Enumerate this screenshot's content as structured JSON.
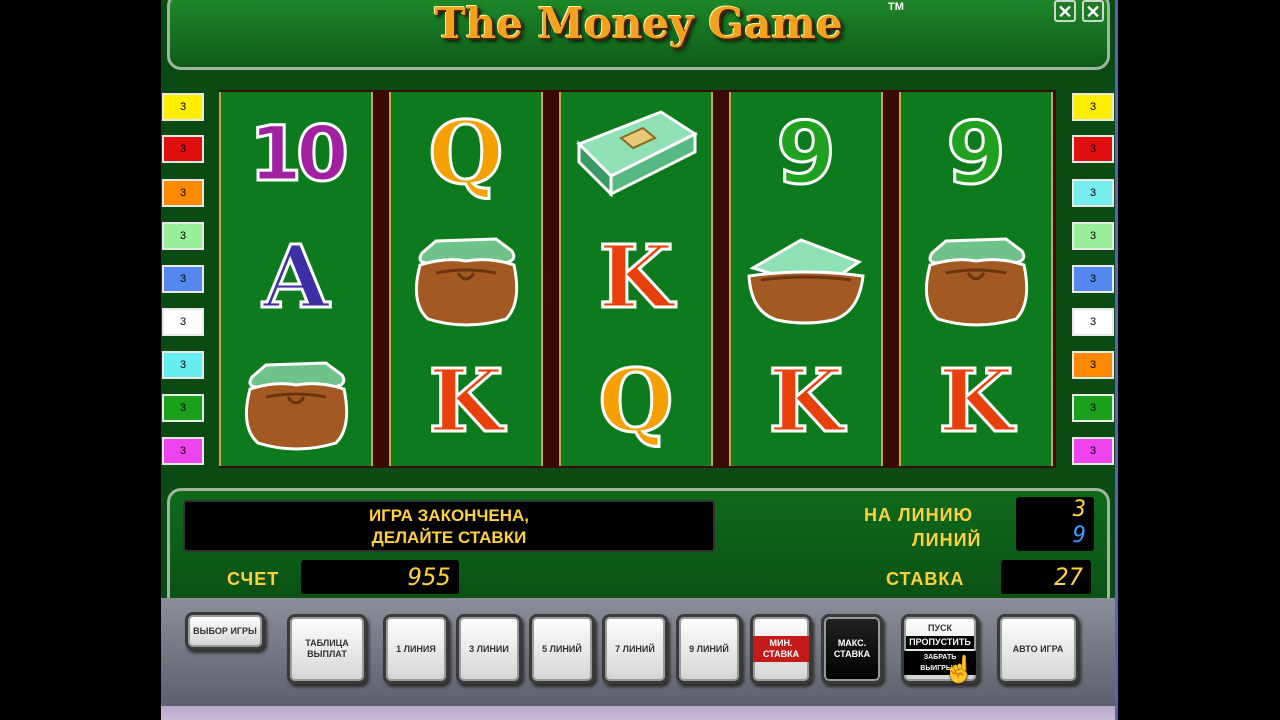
{
  "title": "The Money Game",
  "trademark": "TM",
  "window_buttons": {
    "minimize_glyph": "✕",
    "close_glyph": "✕"
  },
  "line_indicators": {
    "left": [
      {
        "value": "3",
        "color": "#ffee00"
      },
      {
        "value": "3",
        "color": "#e01010"
      },
      {
        "value": "3",
        "color": "#ff8a00"
      },
      {
        "value": "3",
        "color": "#99ee99"
      },
      {
        "value": "3",
        "color": "#5588ee"
      },
      {
        "value": "3",
        "color": "#ffffff"
      },
      {
        "value": "3",
        "color": "#66eeee"
      },
      {
        "value": "3",
        "color": "#1aa01a"
      },
      {
        "value": "3",
        "color": "#ee44ee"
      }
    ],
    "right": [
      {
        "value": "3",
        "color": "#ffee00"
      },
      {
        "value": "3",
        "color": "#e01010"
      },
      {
        "value": "3",
        "color": "#77eeee"
      },
      {
        "value": "3",
        "color": "#99ee99"
      },
      {
        "value": "3",
        "color": "#5588ee"
      },
      {
        "value": "3",
        "color": "#ffffff"
      },
      {
        "value": "3",
        "color": "#ff8a00"
      },
      {
        "value": "3",
        "color": "#1aa01a"
      },
      {
        "value": "3",
        "color": "#ee44ee"
      }
    ]
  },
  "reels": [
    [
      "10",
      "A",
      "money-bag"
    ],
    [
      "Q",
      "money-bag",
      "K"
    ],
    [
      "cash-bundle",
      "K",
      "Q"
    ],
    [
      "9",
      "wallet",
      "K"
    ],
    [
      "9",
      "money-bag",
      "K"
    ]
  ],
  "message": {
    "line1": "ИГРА ЗАКОНЧЕНА,",
    "line2": "ДЕЛАЙТЕ СТАВКИ"
  },
  "per_line_label": "НА ЛИНИЮ",
  "per_line_value": "3",
  "lines_label": "ЛИНИЙ",
  "lines_value": "9",
  "credit_label": "СЧЕТ",
  "credit_value": "955",
  "bet_label": "СТАВКА",
  "bet_value": "27",
  "buttons": {
    "select_game": "ВЫБОР ИГРЫ",
    "paytable": "ТАБЛИЦА ВЫПЛАТ",
    "line1": "1 ЛИНИЯ",
    "line3": "3 ЛИНИИ",
    "line5": "5 ЛИНИЙ",
    "line7": "7 ЛИНИЙ",
    "line9": "9 ЛИНИЙ",
    "min_bet": "МИН. СТАВКА",
    "max_bet": "МАКС. СТАВКА",
    "start_top": "ПУСК",
    "start_mid": "ПРОПУСТИТЬ",
    "start_bottom": "ЗАБРАТЬ ВЫИГРЫШ",
    "auto": "АВТО ИГРА"
  }
}
